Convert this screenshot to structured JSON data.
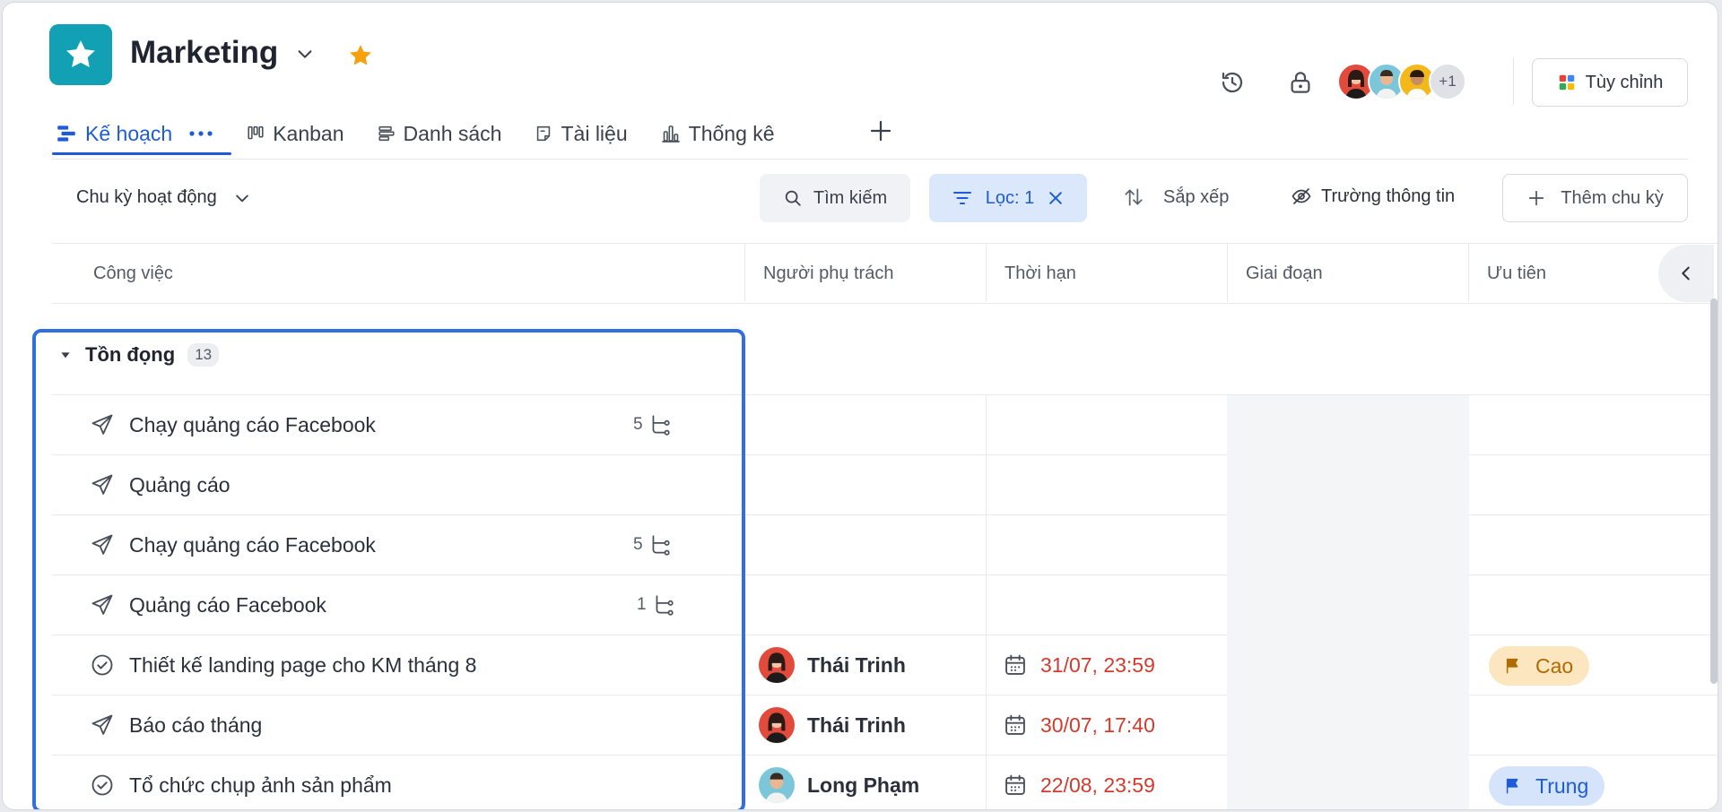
{
  "project": {
    "title": "Marketing",
    "starred": true
  },
  "header": {
    "extra_members": "+1",
    "customize_label": "Tùy chỉnh"
  },
  "tabs": [
    {
      "label": "Kế hoạch",
      "active": true
    },
    {
      "label": "Kanban"
    },
    {
      "label": "Danh sách"
    },
    {
      "label": "Tài liệu"
    },
    {
      "label": "Thống kê"
    }
  ],
  "toolbar": {
    "cycle_label": "Chu kỳ hoạt động",
    "search_label": "Tìm kiếm",
    "filter_label": "Lọc: 1",
    "sort_label": "Sắp xếp",
    "fields_label": "Trường thông tin",
    "add_cycle_label": "Thêm chu kỳ"
  },
  "table": {
    "columns": [
      "Công việc",
      "Người phụ trách",
      "Thời hạn",
      "Giai đoạn",
      "Ưu tiên"
    ],
    "group": {
      "name": "Tồn đọng",
      "count": "13"
    },
    "rows": [
      {
        "task": "Chạy quảng cáo Facebook",
        "type": "campaign",
        "subtasks": "5",
        "assignee": "",
        "due": "",
        "priority": ""
      },
      {
        "task": "Quảng cáo",
        "type": "campaign",
        "subtasks": "",
        "assignee": "",
        "due": "",
        "priority": ""
      },
      {
        "task": "Chạy quảng cáo Facebook",
        "type": "campaign",
        "subtasks": "5",
        "assignee": "",
        "due": "",
        "priority": ""
      },
      {
        "task": "Quảng cáo Facebook",
        "type": "campaign",
        "subtasks": "1",
        "assignee": "",
        "due": "",
        "priority": ""
      },
      {
        "task": "Thiết kế landing page cho KM tháng 8",
        "type": "task",
        "subtasks": "",
        "assignee": "Thái Trinh",
        "due": "31/07, 23:59",
        "priority": "Cao"
      },
      {
        "task": "Báo cáo tháng",
        "type": "campaign",
        "subtasks": "",
        "assignee": "Thái Trinh",
        "due": "30/07, 17:40",
        "priority": ""
      },
      {
        "task": "Tổ chức chụp ảnh sản phẩm",
        "type": "task",
        "subtasks": "",
        "assignee": "Long Phạm",
        "due": "22/08, 23:59",
        "priority": "Trung"
      }
    ]
  },
  "colors": {
    "accent": "#1d5bd8",
    "logo": "#12a0b5",
    "due": "#d23a2e",
    "highlight": "#2f6fe0"
  }
}
